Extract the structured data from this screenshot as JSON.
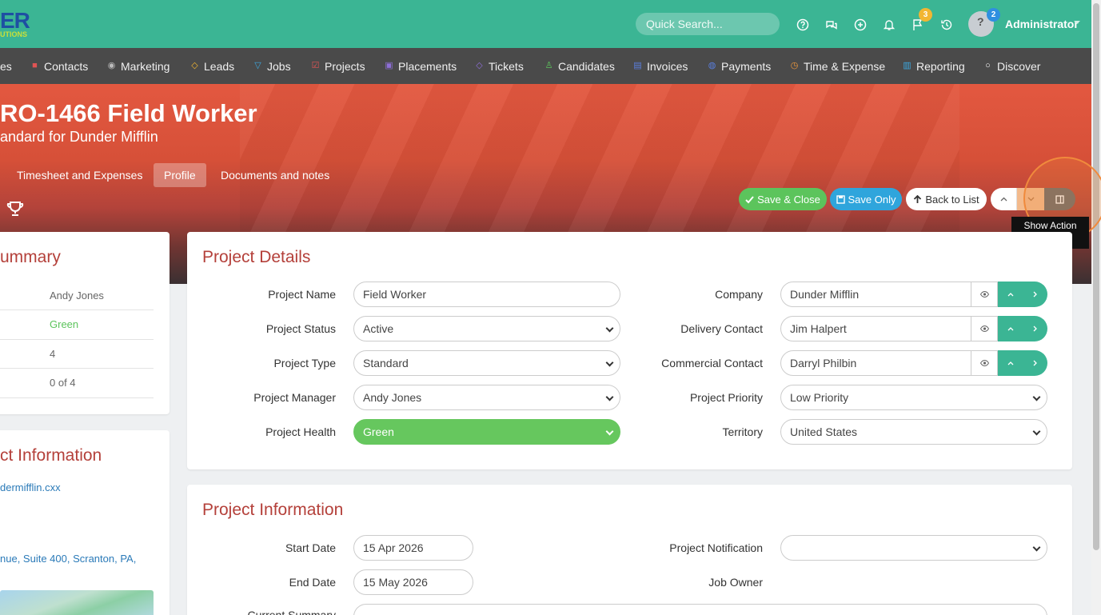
{
  "brand": {
    "logo_main": "ER",
    "logo_sub": "UTIONS"
  },
  "topbar": {
    "search_placeholder": "Quick Search...",
    "icons": [
      "help-icon",
      "chat-icon",
      "add-icon",
      "bell-icon",
      "flag-icon",
      "history-icon"
    ],
    "flag_badge": "3",
    "avatar_badge": "2",
    "user": "Administrator"
  },
  "nav": {
    "items": [
      {
        "label": "es",
        "icon": ""
      },
      {
        "label": "Contacts",
        "icon": "contacts-icon"
      },
      {
        "label": "Marketing",
        "icon": "marketing-icon"
      },
      {
        "label": "Leads",
        "icon": "leads-icon"
      },
      {
        "label": "Jobs",
        "icon": "jobs-icon"
      },
      {
        "label": "Projects",
        "icon": "projects-icon"
      },
      {
        "label": "Placements",
        "icon": "placements-icon"
      },
      {
        "label": "Tickets",
        "icon": "tickets-icon"
      },
      {
        "label": "Candidates",
        "icon": "candidates-icon"
      },
      {
        "label": "Invoices",
        "icon": "invoices-icon"
      },
      {
        "label": "Payments",
        "icon": "payments-icon"
      },
      {
        "label": "Time & Expense",
        "icon": "time-icon"
      },
      {
        "label": "Reporting",
        "icon": "reporting-icon"
      },
      {
        "label": "Discover",
        "icon": "discover-icon"
      }
    ]
  },
  "hero": {
    "title": "RO-1466 Field Worker",
    "subtitle": "andard for Dunder Mifflin",
    "tabs": [
      "Timesheet and Expenses",
      "Profile",
      "Documents and notes"
    ],
    "active_tab": "Profile"
  },
  "actions": {
    "save_close": "Save & Close",
    "save_only": "Save Only",
    "back": "Back to List",
    "tooltip": "Show Action Menu"
  },
  "summary": {
    "title": "ummary",
    "rows": [
      "Andy Jones",
      "Green",
      "4",
      "0 of 4"
    ]
  },
  "left_info": {
    "title": "ct Information",
    "email": "dermifflin.cxx",
    "address": "nue, Suite 400, Scranton, PA,"
  },
  "details": {
    "title": "Project Details",
    "fields": {
      "project_name": {
        "label": "Project Name",
        "value": "Field Worker"
      },
      "project_status": {
        "label": "Project Status",
        "value": "Active"
      },
      "project_type": {
        "label": "Project Type",
        "value": "Standard"
      },
      "project_manager": {
        "label": "Project Manager",
        "value": "Andy Jones"
      },
      "project_health": {
        "label": "Project Health",
        "value": "Green"
      },
      "company": {
        "label": "Company",
        "value": "Dunder Mifflin"
      },
      "delivery_contact": {
        "label": "Delivery Contact",
        "value": "Jim Halpert"
      },
      "commercial_contact": {
        "label": "Commercial Contact",
        "value": "Darryl Philbin"
      },
      "project_priority": {
        "label": "Project Priority",
        "value": "Low Priority"
      },
      "territory": {
        "label": "Territory",
        "value": "United States"
      }
    }
  },
  "projinfo": {
    "title": "Project Information",
    "start_label": "Start Date",
    "start_value": "15 Apr 2026",
    "end_label": "End Date",
    "end_value": "15 May 2026",
    "notification_label": "Project Notification",
    "notification_value": "",
    "owner_label": "Job Owner",
    "current_summary_label": "Current Summary"
  },
  "colors": {
    "topbar": "#3bb594",
    "nav": "#4a4a4a",
    "accent": "#b4403a",
    "green": "#5cc45c",
    "blue": "#2fa5dc"
  }
}
